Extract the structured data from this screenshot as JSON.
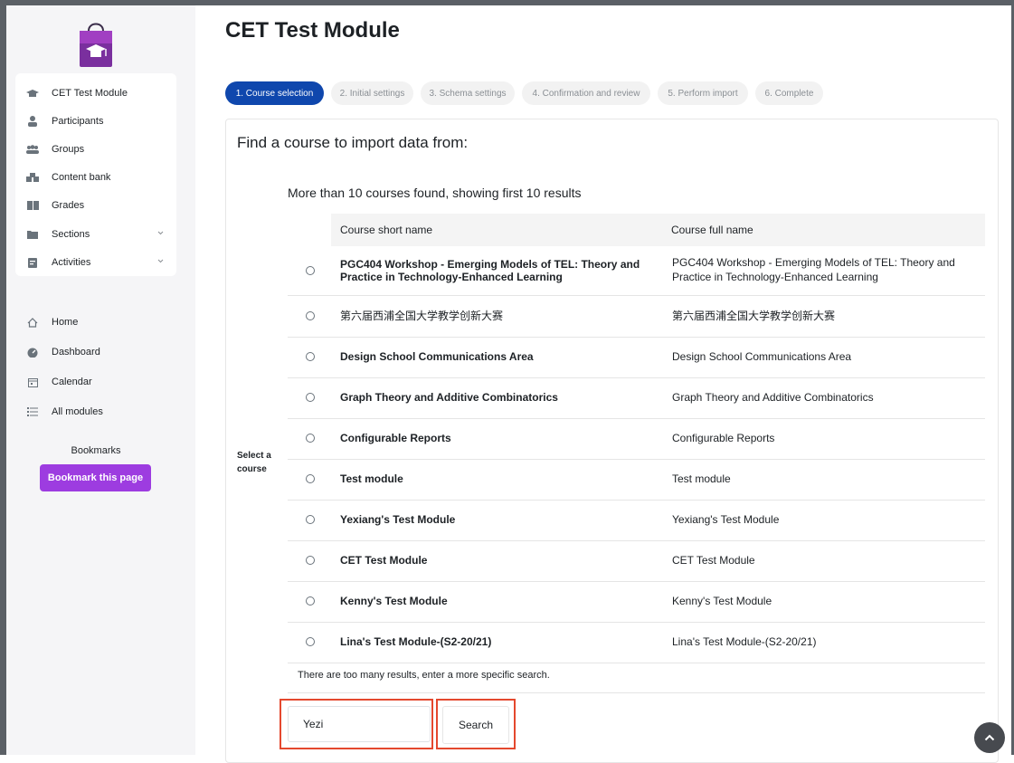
{
  "page_title": "CET Test Module",
  "sidebar": {
    "items": [
      {
        "label": "CET Test Module",
        "icon": "graduation-cap-icon"
      },
      {
        "label": "Participants",
        "icon": "user-icon"
      },
      {
        "label": "Groups",
        "icon": "users-icon"
      },
      {
        "label": "Content bank",
        "icon": "cubes-icon"
      },
      {
        "label": "Grades",
        "icon": "book-icon"
      },
      {
        "label": "Sections",
        "icon": "folder-icon"
      },
      {
        "label": "Activities",
        "icon": "activities-icon"
      }
    ],
    "secondary": [
      {
        "label": "Home",
        "icon": "home-icon"
      },
      {
        "label": "Dashboard",
        "icon": "dashboard-icon"
      },
      {
        "label": "Calendar",
        "icon": "calendar-icon"
      },
      {
        "label": "All modules",
        "icon": "list-icon"
      }
    ],
    "bookmarks_label": "Bookmarks",
    "bookmark_button": "Bookmark this page"
  },
  "steps": [
    "1. Course selection",
    "2. Initial settings",
    "3. Schema settings",
    "4. Confirmation and review",
    "5. Perform import",
    "6. Complete"
  ],
  "card_title": "Find a course to import data from:",
  "found_text": "More than 10 courses found, showing first 10 results",
  "select_label": "Select a course",
  "table": {
    "headers": [
      "Course short name",
      "Course full name"
    ],
    "rows": [
      {
        "short": "PGC404 Workshop - Emerging Models of TEL: Theory and Practice in Technology-Enhanced Learning",
        "full": "PGC404 Workshop - Emerging Models of TEL: Theory and Practice in Technology-Enhanced Learning"
      },
      {
        "short": "第六届西浦全国大学教学创新大赛",
        "full": "第六届西浦全国大学教学创新大赛"
      },
      {
        "short": "Design School Communications Area",
        "full": "Design School Communications Area"
      },
      {
        "short": "Graph Theory and Additive Combinatorics",
        "full": "Graph Theory and Additive Combinatorics"
      },
      {
        "short": "Configurable Reports",
        "full": "Configurable Reports"
      },
      {
        "short": "Test module",
        "full": "Test module"
      },
      {
        "short": "Yexiang's Test Module",
        "full": "Yexiang's Test Module"
      },
      {
        "short": "CET Test Module",
        "full": "CET Test Module"
      },
      {
        "short": "Kenny's Test Module",
        "full": "Kenny's Test Module"
      },
      {
        "short": "Lina's Test Module-(S2-20/21)",
        "full": "Lina's Test Module-(S2-20/21)"
      }
    ]
  },
  "too_many_note": "There are too many results, enter a more specific search.",
  "search": {
    "value": "Yezi",
    "button": "Search"
  },
  "colors": {
    "accent": "#0f47ad",
    "bookmark": "#9d3ce0",
    "highlight": "#e4482e"
  }
}
